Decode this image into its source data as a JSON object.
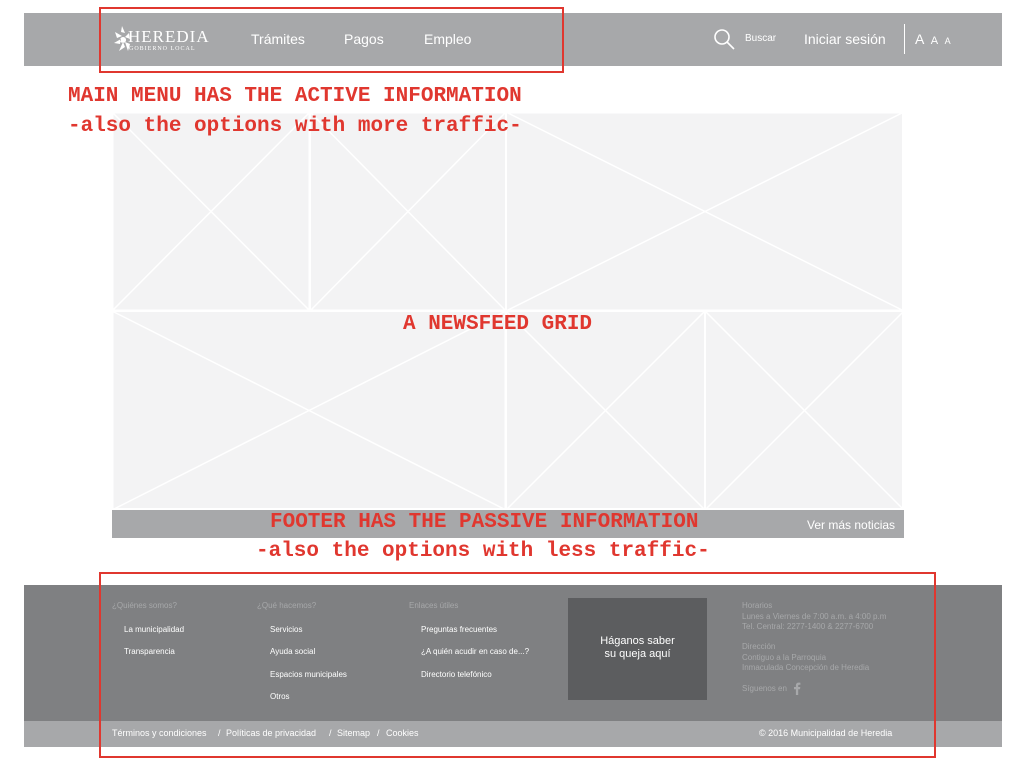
{
  "header": {
    "logo_text": "HEREDIA",
    "logo_sub": "GOBIERNO LOCAL",
    "nav": [
      "Trámites",
      "Pagos",
      "Empleo"
    ],
    "search_label": "Buscar",
    "login_label": "Iniciar sesión",
    "font_sizes": [
      "A",
      "A",
      "A"
    ]
  },
  "annotations": {
    "menu_line1": "MAIN MENU HAS THE ACTIVE INFORMATION",
    "menu_line2": "-also the options with more traffic-",
    "newsfeed": "A NEWSFEED GRID",
    "footer_line1": "FOOTER HAS THE PASSIVE INFORMATION",
    "footer_line2": "-also the options with less traffic-",
    "color": "#e0372f"
  },
  "newsfeed": {
    "more_label": "Ver más noticias"
  },
  "footer": {
    "col1": {
      "heading": "¿Quiénes somos?",
      "links": [
        "La municipalidad",
        "Transparencia"
      ]
    },
    "col2": {
      "heading": "¿Qué hacemos?",
      "links": [
        "Servicios",
        "Ayuda social",
        "Espacios municipales",
        "Otros"
      ]
    },
    "col3": {
      "heading": "Enlaces útiles",
      "links": [
        "Preguntas frecuentes",
        "¿A quién acudir en caso de...?",
        "Directorio telefónico"
      ]
    },
    "complaint": {
      "line1": "Háganos saber",
      "line2": "su queja aquí"
    },
    "info": {
      "hours_title": "Horarios",
      "hours_line1": "Lunes a Viernes de 7:00 a.m. a 4:00 p.m",
      "hours_line2": "Tel. Central: 2277-1400 & 2277-6700",
      "address_title": "Dirección",
      "address_line1": "Contiguo a la Parroquia",
      "address_line2": "Inmaculada Concepción de Heredia",
      "social_label": "Síguenos en",
      "social_icon": "facebook-icon"
    },
    "legal": [
      "Términos y condiciones",
      "Políticas de privacidad",
      "Sitemap",
      "Cookies"
    ],
    "legal_separator": "/",
    "copyright": "© 2016 Municipalidad de Heredia"
  },
  "colors": {
    "header_bg": "#a7a8aa",
    "footer_bg": "#7f8082",
    "complaint_bg": "#5c5d5f",
    "placeholder": "#f2f2f2"
  }
}
